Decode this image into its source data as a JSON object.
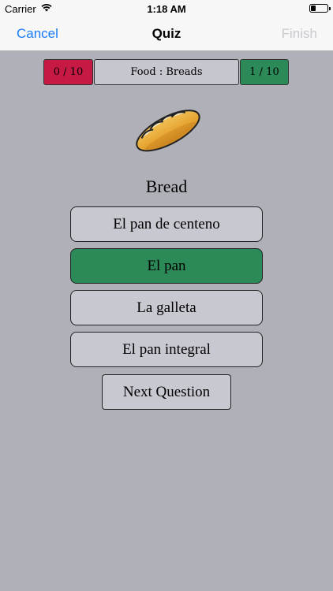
{
  "status_bar": {
    "carrier": "Carrier",
    "time": "1:18 AM"
  },
  "nav": {
    "cancel_label": "Cancel",
    "title": "Quiz",
    "finish_label": "Finish"
  },
  "score": {
    "wrong": "0 / 10",
    "category": "Food : Breads",
    "right": "1 / 10"
  },
  "colors": {
    "wrong_bg": "#c61a45",
    "right_bg": "#2b8a57",
    "accent": "#1a7cf6",
    "background": "#b0b0b8"
  },
  "question": {
    "icon": "bread-icon",
    "word": "Bread"
  },
  "answers": [
    {
      "label": "El pan de centeno",
      "state": "neutral"
    },
    {
      "label": "El pan",
      "state": "correct"
    },
    {
      "label": "La galleta",
      "state": "neutral"
    },
    {
      "label": "El pan integral",
      "state": "neutral"
    }
  ],
  "next_button_label": "Next Question"
}
